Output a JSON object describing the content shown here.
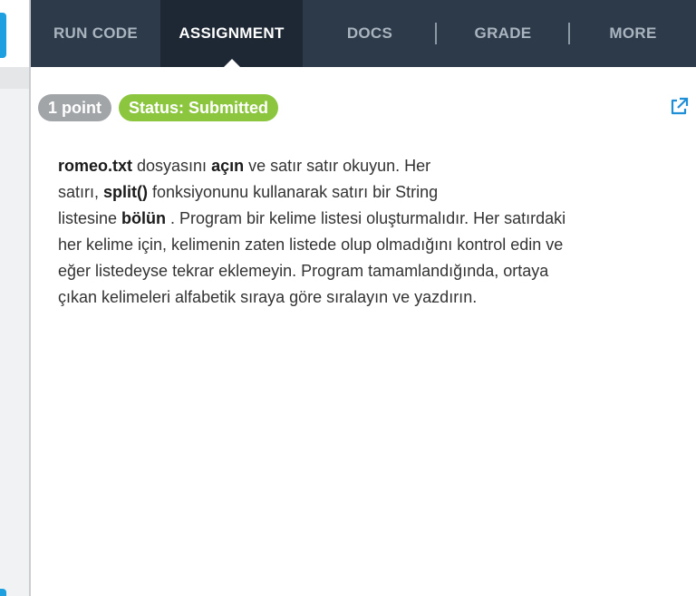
{
  "tabs": [
    {
      "label": "RUN CODE",
      "active": false
    },
    {
      "label": "ASSIGNMENT",
      "active": true
    },
    {
      "label": "DOCS",
      "active": false
    },
    {
      "label": "GRADE",
      "active": false
    },
    {
      "label": "MORE",
      "active": false
    }
  ],
  "badges": {
    "points": "1 point",
    "status": "Status: Submitted"
  },
  "icons": {
    "external_link": "external-link-icon"
  },
  "instructions": {
    "l1_b1": "romeo.txt",
    "l1_t1": " dosyasını ",
    "l1_b2": "açın",
    "l1_t2": " ve satır satır okuyun. Her",
    "l2_t1": "satırı, ",
    "l2_b1": "split()",
    "l2_t2": " fonksiyonunu kullanarak satırı bir String",
    "l3_t1": "listesine ",
    "l3_b1": "bölün",
    "l3_t2": " . Program bir kelime listesi oluşturmalıdır. Her satırdaki",
    "l4": "her kelime için, kelimenin zaten listede olup olmadığını kontrol edin ve",
    "l5": "eğer listedeyse tekrar eklemeyin. Program tamamlandığında, ortaya",
    "l6": "çıkan kelimeleri alfabetik sıraya göre sıralayın ve yazdırın."
  },
  "colors": {
    "nav_bg": "#2c3a4a",
    "nav_active_bg": "#1d2834",
    "points_badge": "#a2a5a8",
    "status_badge": "#8cc63f",
    "link_icon": "#1e8fd6"
  }
}
